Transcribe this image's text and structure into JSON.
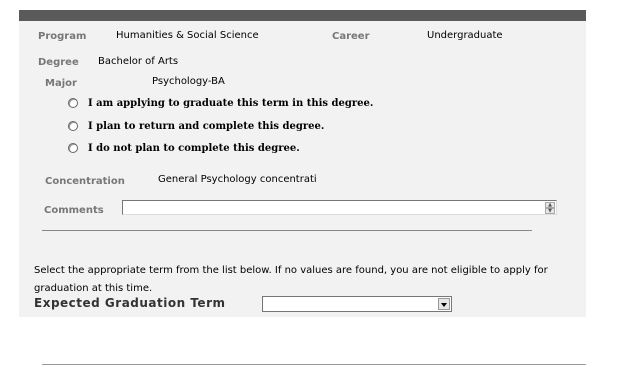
{
  "program": {
    "label": "Program",
    "value": "Humanities & Social Science"
  },
  "career": {
    "label": "Career",
    "value": "Undergraduate"
  },
  "degree": {
    "label": "Degree",
    "value": "Bachelor of Arts"
  },
  "major": {
    "label": "Major",
    "value": "Psychology-BA"
  },
  "options": [
    "I am applying to graduate this term in this degree.",
    "I plan to return and complete this degree.",
    "I do not plan to complete this degree."
  ],
  "concentration": {
    "label": "Concentration",
    "value": "General Psychology concentrati"
  },
  "comments": {
    "label": "Comments",
    "value": ""
  },
  "instruction": "Select the appropriate term from the list below. If no values are found, you are not eligible to apply for graduation at this time.",
  "expected_term": {
    "label": "Expected Graduation Term",
    "value": ""
  }
}
